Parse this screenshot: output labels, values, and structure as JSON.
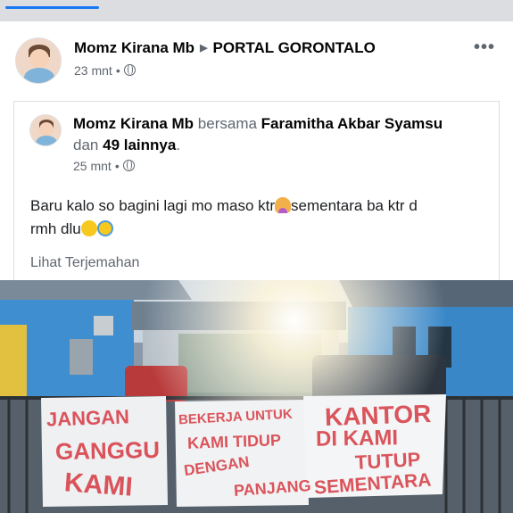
{
  "post": {
    "author": "Momz Kirana Mb",
    "group": "PORTAL GORONTALO",
    "time": "23 mnt",
    "dot": "•"
  },
  "shared": {
    "author": "Momz Kirana Mb",
    "with_word": "bersama",
    "tagged": "Faramitha Akbar Syamsu",
    "and_word": "dan",
    "others": "49 lainnya",
    "period": ".",
    "time": "25 mnt",
    "dot": "•",
    "text_line1": "Baru kalo so bagini lagi mo maso ktr",
    "text_line1b": "sementara ba ktr d",
    "text_line2": "rmh dlu",
    "translate_link": "Lihat Terjemahan"
  },
  "photo": {
    "banner_left": [
      "JANGAN",
      "GANGGU",
      "KAMI"
    ],
    "banner_middle": [
      "BEKERJA UNTUK",
      "KAMI TIDUP",
      "DENGAN",
      "PANJANG"
    ],
    "banner_right": [
      "KANTOR",
      "DI KAMI",
      "TUTUP",
      "SEMENTARA"
    ]
  },
  "icons": {
    "globe": "globe-icon",
    "more": "more-options-icon",
    "emoji_1": "woman-tipping-hand-emoji",
    "emoji_2": "thinking-face-emoji",
    "emoji_3": "screaming-face-emoji"
  },
  "colors": {
    "accent": "#1877f2",
    "muted_text": "#606770",
    "banner_paint": "#d8434b"
  }
}
